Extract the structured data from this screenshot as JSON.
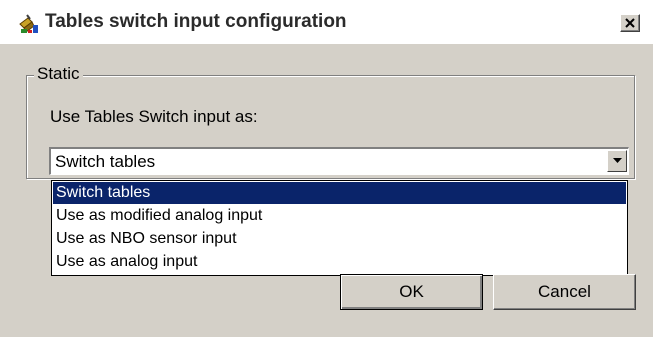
{
  "window": {
    "title": "Tables switch input configuration",
    "app_icon": "tables-app-icon",
    "close_icon": "close-icon"
  },
  "group": {
    "legend": "Static",
    "prompt": "Use Tables Switch input as:"
  },
  "combo": {
    "selected_value": "Switch tables",
    "arrow_icon": "dropdown-arrow-icon",
    "options": [
      "Switch tables",
      "Use as modified analog input",
      "Use as NBO sensor input",
      "Use as analog input"
    ],
    "selected_index": 0
  },
  "buttons": {
    "ok": "OK",
    "cancel": "Cancel"
  },
  "colors": {
    "face": "#d4d0c8",
    "highlight": "#0a246a"
  }
}
